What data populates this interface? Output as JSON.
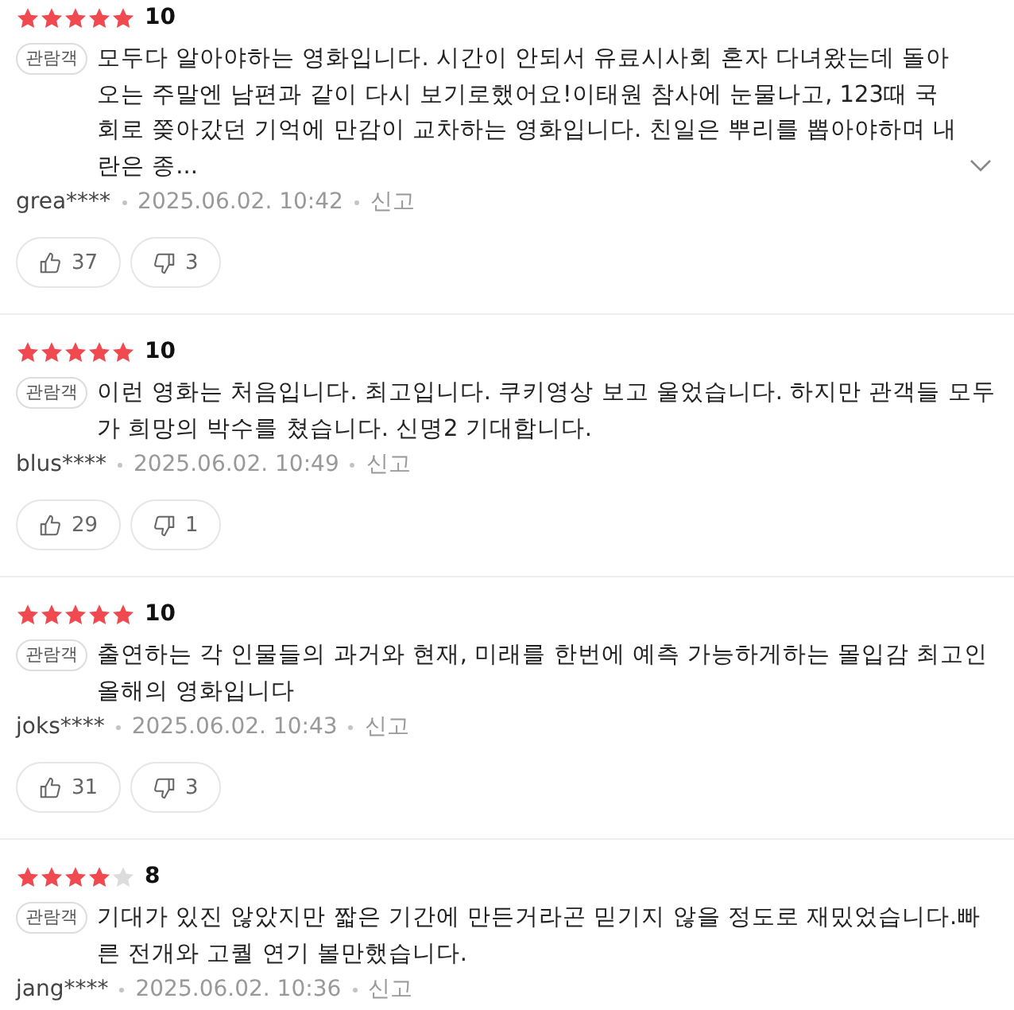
{
  "reviews": [
    {
      "stars": 5,
      "score": "10",
      "badge": "관람객",
      "text": "모두다 알아야하는 영화입니다. 시간이 안되서 유료시사회 혼자 다녀왔는데 돌아오는 주말엔 남편과 같이 다시 보기로했어요!이태원 참사에 눈물나고, 123때 국회로 쫒아갔던 기억에 만감이 교차하는 영화입니다. 친일은 뿌리를 뽑아야하며 내란은 종...",
      "truncated": true,
      "user": "grea****",
      "date": "2025.06.02. 10:42",
      "report": "신고",
      "likes": "37",
      "dislikes": "3"
    },
    {
      "stars": 5,
      "score": "10",
      "badge": "관람객",
      "text": "이런 영화는 처음입니다. 최고입니다. 쿠키영상 보고 울었습니다. 하지만 관객들 모두가 희망의 박수를 쳤습니다. 신명2 기대합니다.",
      "truncated": false,
      "user": "blus****",
      "date": "2025.06.02. 10:49",
      "report": "신고",
      "likes": "29",
      "dislikes": "1"
    },
    {
      "stars": 5,
      "score": "10",
      "badge": "관람객",
      "text": "출연하는 각 인물들의 과거와 현재, 미래를 한번에 예측 가능하게하는 몰입감 최고인 올해의 영화입니다",
      "truncated": false,
      "user": "joks****",
      "date": "2025.06.02. 10:43",
      "report": "신고",
      "likes": "31",
      "dislikes": "3"
    },
    {
      "stars": 4,
      "score": "8",
      "badge": "관람객",
      "text": "기대가 있진 않았지만 짧은 기간에 만든거라곤 믿기지 않을 정도로 재밌었습니다.빠른 전개와 고퀄 연기 볼만했습니다.",
      "truncated": false,
      "user": "jang****",
      "date": "2025.06.02. 10:36",
      "report": "신고"
    }
  ]
}
